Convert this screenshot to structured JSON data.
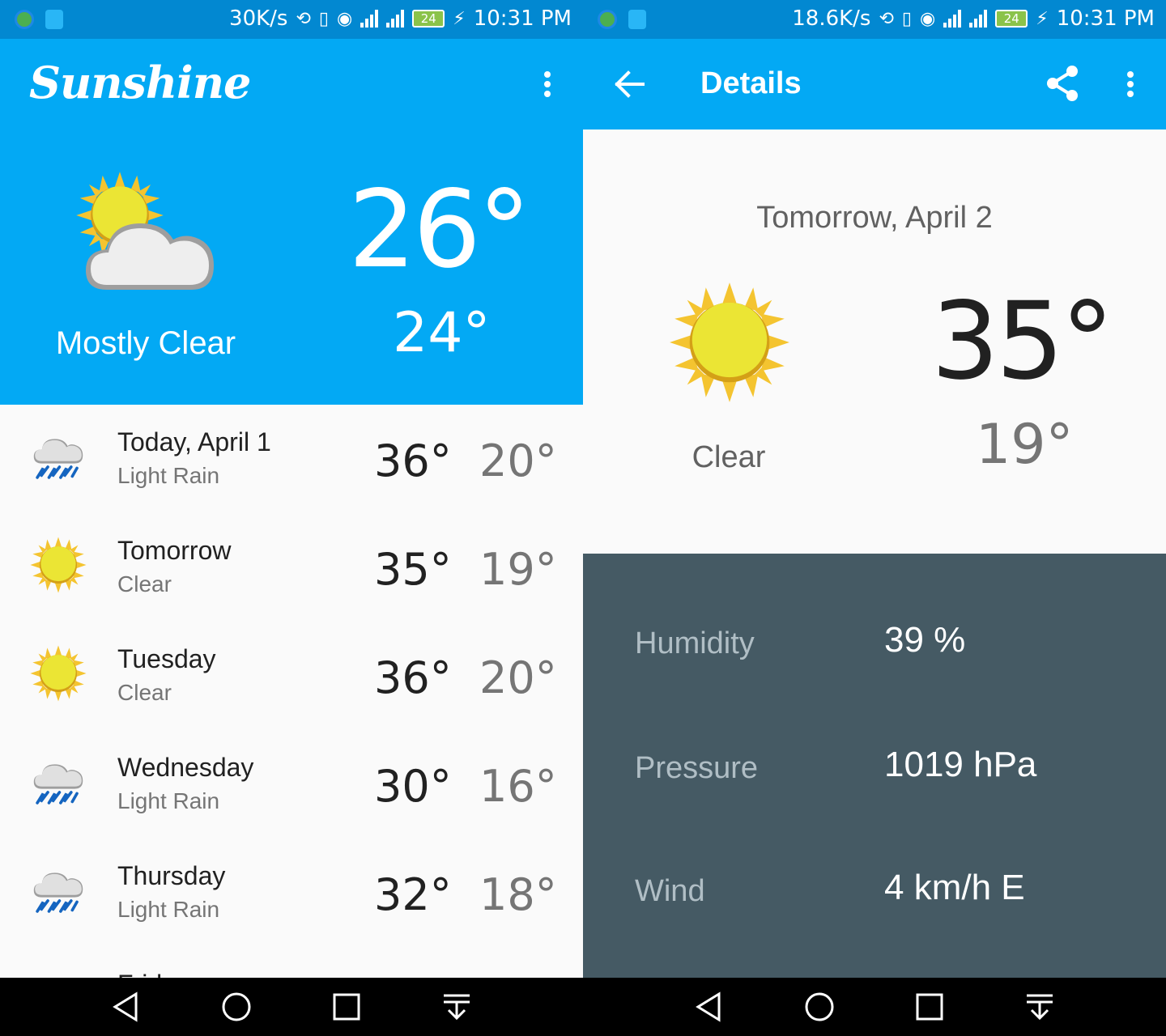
{
  "left": {
    "status": {
      "speed": "30K/s",
      "time": "10:31 PM",
      "battery": "24"
    },
    "app_title": "Sunshine",
    "today": {
      "high": "26°",
      "low": "24°",
      "desc": "Mostly Clear",
      "icon": "mostly-clear-icon"
    },
    "forecast": [
      {
        "day": "Today, April 1",
        "desc": "Light Rain",
        "high": "36°",
        "low": "20°",
        "icon": "light-rain-icon"
      },
      {
        "day": "Tomorrow",
        "desc": "Clear",
        "high": "35°",
        "low": "19°",
        "icon": "clear-icon"
      },
      {
        "day": "Tuesday",
        "desc": "Clear",
        "high": "36°",
        "low": "20°",
        "icon": "clear-icon"
      },
      {
        "day": "Wednesday",
        "desc": "Light Rain",
        "high": "30°",
        "low": "16°",
        "icon": "light-rain-icon"
      },
      {
        "day": "Thursday",
        "desc": "Light Rain",
        "high": "32°",
        "low": "18°",
        "icon": "light-rain-icon"
      },
      {
        "day": "Friday",
        "desc": "",
        "high": "",
        "low": "",
        "icon": "cloud-icon"
      }
    ]
  },
  "right": {
    "status": {
      "speed": "18.6K/s",
      "time": "10:31 PM",
      "battery": "24"
    },
    "title": "Details",
    "date": "Tomorrow, April 2",
    "high": "35°",
    "low": "19°",
    "desc": "Clear",
    "icon": "clear-icon",
    "extras": {
      "humidity_label": "Humidity",
      "humidity_value": "39 %",
      "pressure_label": "Pressure",
      "pressure_value": "1019 hPa",
      "wind_label": "Wind",
      "wind_value": "4 km/h E"
    }
  },
  "colors": {
    "primary": "#03a9f4",
    "primary_dark": "#0288d1",
    "extras_bg": "#455a64",
    "sun": "#fbc02d",
    "cloud": "#e0e0e0",
    "rain": "#1e88e5"
  }
}
